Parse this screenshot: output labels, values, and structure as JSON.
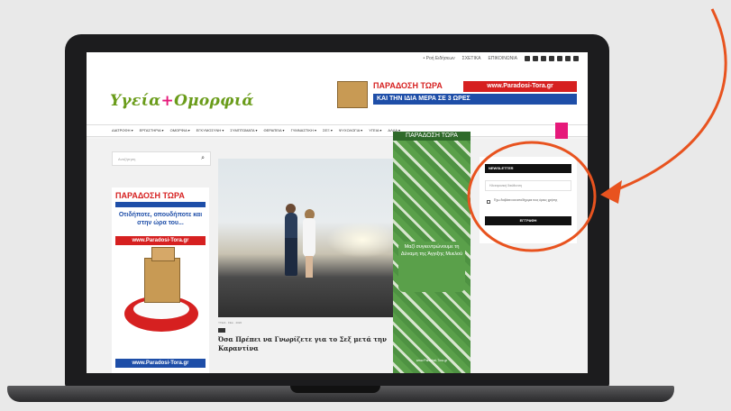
{
  "site": {
    "logo_text": "Υγεία",
    "logo_plus": "+",
    "logo_text2": "Ομορφιά",
    "top_links": [
      "• Ροή Ειδήσεων",
      "ΣΧΕΤΙΚΑ",
      "ΕΠΙΚΟΙΝΩΝΙΑ"
    ]
  },
  "header_banner": {
    "line1": "ΠΑΡΑΔΟΣΗ ΤΩΡΑ",
    "url": "www.Paradosi-Tora.gr",
    "line2": "ΚΑΙ ΤΗΝ ΙΔΙΑ ΜΕΡΑ ΣΕ 3 ΩΡΕΣ"
  },
  "nav": {
    "items": [
      "ΔΙΑΤΡΟΦΗ",
      "ΕΡΓΑΣΤΗΡΙΑ",
      "ΟΜΟΡΦΙΑ",
      "ΕΓΚΥΜΟΣΥΝΗ",
      "ΣΥΜΠΤΩΜΑΤΑ",
      "ΘΕΡΑΠΕΙΑ",
      "ΓΥΜΝΑΣΤΙΚΗ",
      "ΣΕΞ",
      "ΨΥΧΟΛΟΓΙΑ",
      "ΥΓΕΙΑ",
      "ΑΛΛΑ"
    ]
  },
  "search": {
    "placeholder": "Αναζήτηση",
    "icon": "search-icon"
  },
  "left_ad": {
    "title": "ΠΑΡΑΔΟΣΗ ΤΩΡΑ",
    "text": "Οτιδήποτε, οπουδήποτε και στην ώρα του...",
    "url": "www.Paradosi-Tora.gr",
    "url_bottom": "www.Paradosi-Tora.gr"
  },
  "article": {
    "meta": "ΥΓΕΙΑ · ΣΕΞ · 2020",
    "title": "Όσα Πρέπει να Γνωρίζετε για το Σεξ μετά την Καραντίνα"
  },
  "mid_ad": {
    "top": "ΠΑΡΑΔΟΣΗ ΤΩΡΑ",
    "text": "Μαζί συγκεντρώνουμε τη Δύναμη της Άγγιξης Μυελού",
    "url": "www.Paradosi-Tora.gr"
  },
  "newsletter": {
    "header": "NEWSLETTER",
    "input_placeholder": "Ηλεκτρονική διεύθυνση",
    "consent": "Έχω διαβάσει και αποδέχομαι τους όρους χρήσης",
    "button": "ΕΓΓΡΑΦΗ"
  },
  "annotation": {
    "color": "#e8531f"
  }
}
